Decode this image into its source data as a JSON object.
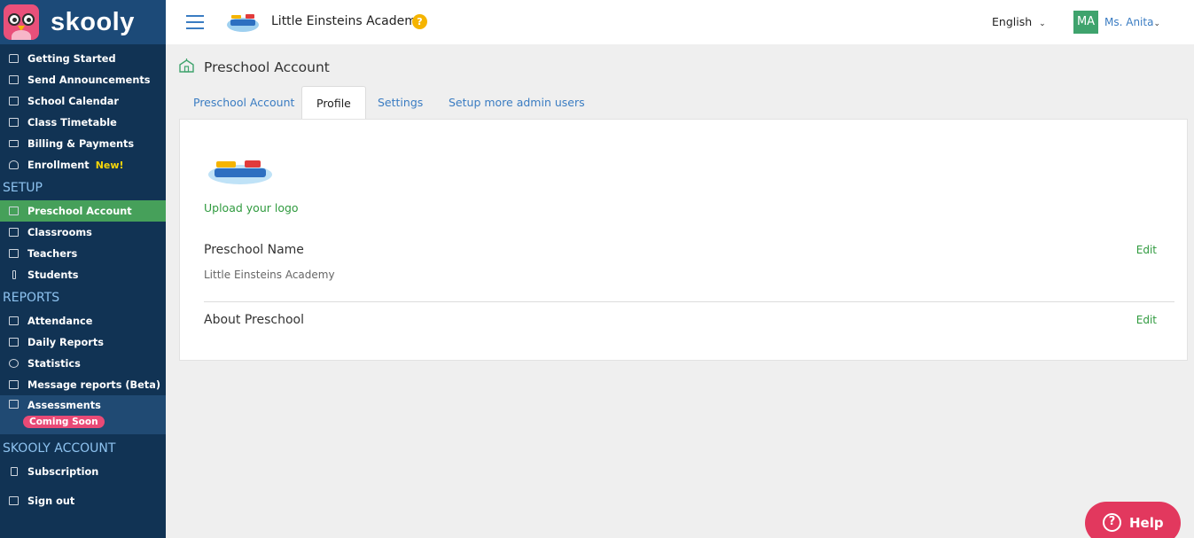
{
  "brand": {
    "name": "skooly",
    "icon": "owl-icon"
  },
  "topbar": {
    "school_name": "Little Einsteins Academy",
    "help_badge": "?",
    "language": "English",
    "user_initials": "MA",
    "user_name": "Ms. Anita"
  },
  "sidebar": {
    "main_items": [
      {
        "label": "Getting Started",
        "icon": "home-icon"
      },
      {
        "label": "Send Announcements",
        "icon": "megaphone-icon"
      },
      {
        "label": "School Calendar",
        "icon": "calendar-icon"
      },
      {
        "label": "Class Timetable",
        "icon": "calendar-icon"
      },
      {
        "label": "Billing & Payments",
        "icon": "card-icon"
      },
      {
        "label": "Enrollment",
        "icon": "user-add-icon",
        "badge": "New!"
      }
    ],
    "setup_title": "SETUP",
    "setup_items": [
      {
        "label": "Preschool Account",
        "icon": "school-icon"
      },
      {
        "label": "Classrooms",
        "icon": "classroom-icon"
      },
      {
        "label": "Teachers",
        "icon": "teacher-icon"
      },
      {
        "label": "Students",
        "icon": "pencil-icon"
      }
    ],
    "reports_title": "REPORTS",
    "reports_items": [
      {
        "label": "Attendance",
        "icon": "attendance-icon"
      },
      {
        "label": "Daily Reports",
        "icon": "report-icon"
      },
      {
        "label": "Statistics",
        "icon": "pie-icon"
      },
      {
        "label": "Message reports (Beta)",
        "icon": "report-icon"
      },
      {
        "label": "Assessments",
        "icon": "calendar-icon",
        "badge": "Coming Soon"
      }
    ],
    "account_title": "SKOOLY ACCOUNT",
    "account_items": [
      {
        "label": "Subscription",
        "icon": "bookmark-icon"
      },
      {
        "label": "Sign out",
        "icon": "sign-out-icon"
      }
    ]
  },
  "page": {
    "title": "Preschool Account",
    "tabs": [
      "Preschool Account",
      "Profile",
      "Settings",
      "Setup more admin users"
    ],
    "active_tab": "Profile",
    "upload_logo": "Upload your logo",
    "fields": [
      {
        "label": "Preschool Name",
        "value": "Little Einsteins Academy",
        "action": "Edit"
      },
      {
        "label": "About Preschool",
        "value": "",
        "action": "Edit"
      }
    ]
  },
  "help_button": {
    "label": "Help"
  },
  "colors": {
    "sidebar_bg": "#113354",
    "brand_bg": "#1c4a78",
    "active_green": "#46a05a",
    "link_blue": "#3a7cc2",
    "help_pink": "#e2385e"
  }
}
